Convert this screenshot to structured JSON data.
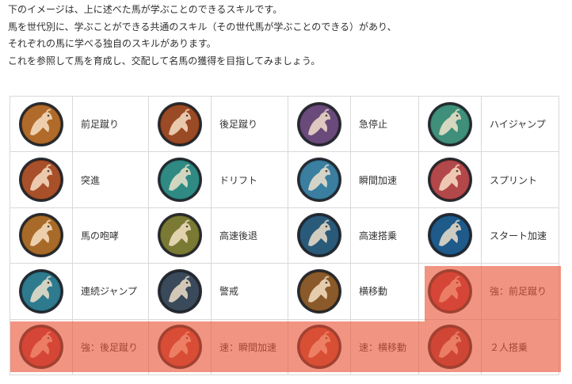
{
  "intro": [
    "下のイメージは、上に述べた馬が学ぶことのできるスキルです。",
    "馬を世代別に、学ぶことができる共通のスキル（その世代馬が学ぶことのできる）があり、",
    "それぞれの馬に学べる独自のスキルがあります。",
    "これを参照して馬を育成し、交配して名馬の獲得を目指してみましょう。"
  ],
  "skills": [
    [
      {
        "name": "前足蹴り",
        "icon": "horse-kick-icon",
        "color": "#b06a2a"
      },
      {
        "name": "後足蹴り",
        "icon": "horse-back-kick-icon",
        "color": "#9a4a24"
      },
      {
        "name": "急停止",
        "icon": "horse-stop-icon",
        "color": "#6a4a7a"
      },
      {
        "name": "ハイジャンプ",
        "icon": "horse-jump-icon",
        "color": "#3f8f7a"
      }
    ],
    [
      {
        "name": "突進",
        "icon": "horse-rush-icon",
        "color": "#a8502a"
      },
      {
        "name": "ドリフト",
        "icon": "horse-drift-icon",
        "color": "#2f8a84"
      },
      {
        "name": "瞬間加速",
        "icon": "horse-burst-icon",
        "color": "#3a7ea0"
      },
      {
        "name": "スプリント",
        "icon": "horse-sprint-icon",
        "color": "#b2484a"
      }
    ],
    [
      {
        "name": "馬の咆哮",
        "icon": "horse-roar-icon",
        "color": "#a86a28"
      },
      {
        "name": "高速後退",
        "icon": "horse-retreat-icon",
        "color": "#7a7a34"
      },
      {
        "name": "高速搭乗",
        "icon": "horse-mount-icon",
        "color": "#2a5a7a"
      },
      {
        "name": "スタート加速",
        "icon": "horse-start-icon",
        "color": "#1e5a8a"
      }
    ],
    [
      {
        "name": "連続ジャンプ",
        "icon": "horse-double-jump-icon",
        "color": "#2e7a8e"
      },
      {
        "name": "警戒",
        "icon": "horse-alert-icon",
        "color": "#3a4a5a"
      },
      {
        "name": "横移動",
        "icon": "horse-sidestep-icon",
        "color": "#8a5a2a"
      },
      {
        "name": "強：前足蹴り",
        "icon": "horse-kick-strong-icon",
        "color": "#b8343a"
      }
    ],
    [
      {
        "name": "強：後足蹴り",
        "icon": "horse-back-kick-strong-icon",
        "color": "#b8343a"
      },
      {
        "name": "速：瞬間加速",
        "icon": "horse-burst-fast-icon",
        "color": "#c04238"
      },
      {
        "name": "速：横移動",
        "icon": "horse-sidestep-fast-icon",
        "color": "#c04a36"
      },
      {
        "name": "２人搭乗",
        "icon": "horse-double-ride-icon",
        "color": "#a83236"
      }
    ]
  ]
}
